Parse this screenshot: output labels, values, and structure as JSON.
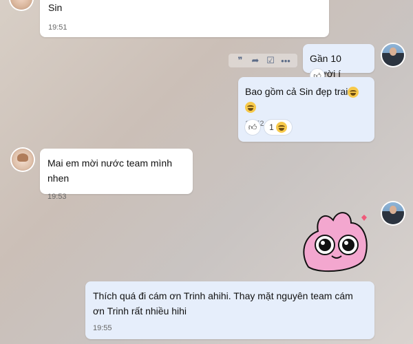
{
  "messages": [
    {
      "text": "Sin",
      "time": "19:51"
    },
    {
      "text": "Gần 10 người í"
    },
    {
      "text": "Bao gồm cả Sin đẹp trai",
      "time": "19:52",
      "reaction_count": "1"
    },
    {
      "text": "Mai em mời nước team mình nhen",
      "time": "19:53"
    },
    {
      "text": "Thích quá đi cám ơn Trinh ahihi. Thay mặt nguyên team cám ơn Trinh rất nhiều hihi",
      "time": "19:55"
    }
  ],
  "toolbar": {
    "icons": [
      "quote-icon",
      "share-icon",
      "todo-icon",
      "more-icon"
    ]
  },
  "colors": {
    "bubble_self": "#e6eefb",
    "bubble_other": "#ffffff",
    "sticker_pink": "#f3a7cf"
  }
}
